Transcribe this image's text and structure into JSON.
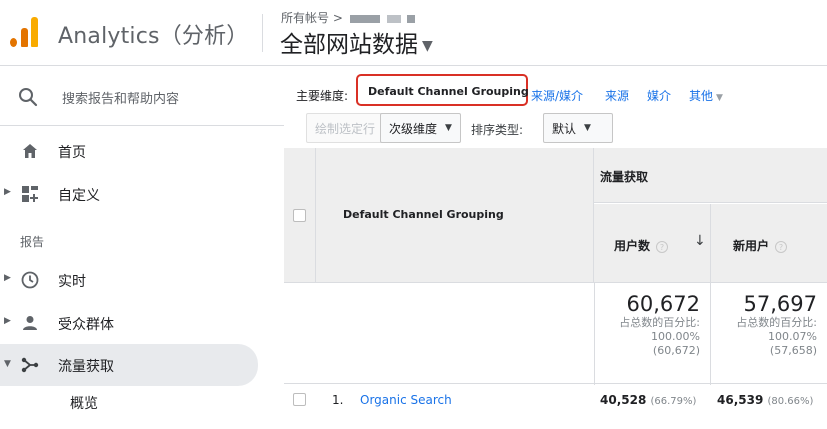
{
  "header": {
    "app_title": "Analytics（分析）",
    "breadcrumb_label": "所有帐号 >",
    "view_title": "全部网站数据"
  },
  "sidebar": {
    "search_placeholder": "搜索报告和帮助内容",
    "items_top": [
      {
        "label": "首页",
        "icon": "home-icon"
      },
      {
        "label": "自定义",
        "icon": "dashboard-icon"
      }
    ],
    "section_label": "报告",
    "items_reports": [
      {
        "label": "实时",
        "icon": "clock-icon"
      },
      {
        "label": "受众群体",
        "icon": "person-icon"
      },
      {
        "label": "流量获取",
        "icon": "acquisition-icon"
      }
    ],
    "sub_item": "概览"
  },
  "main": {
    "primary_dimension_label": "主要维度:",
    "active_dimension": "Default Channel Grouping",
    "dimension_links": [
      "来源/媒介",
      "来源",
      "媒介",
      "其他"
    ],
    "toolbar": {
      "plot_rows": "绘制选定行",
      "secondary_dimension": "次级维度",
      "sort_type_label": "排序类型:",
      "sort_value": "默认"
    },
    "table": {
      "dim_header": "Default Channel Grouping",
      "group_header": "流量获取",
      "col_users": "用户数",
      "col_new_users": "新用户",
      "totals": {
        "users": "60,672",
        "users_pct_label": "占总数的百分比:",
        "users_pct": "100.00%",
        "users_abs": "(60,672)",
        "new_users": "57,697",
        "new_users_pct_label": "占总数的百分比:",
        "new_users_pct": "100.07%",
        "new_users_abs": "(57,658)"
      },
      "first_row": {
        "index": "1.",
        "name": "Organic Search",
        "users": "40,528",
        "users_pct": "(66.79%)",
        "new_users": "46,539",
        "new_users_pct": "(80.66%)"
      }
    }
  },
  "colors": {
    "accent": "#1a73e8",
    "highlight_border": "#d93025",
    "logo_orange": "#e37400",
    "logo_yellow": "#f9ab00"
  }
}
